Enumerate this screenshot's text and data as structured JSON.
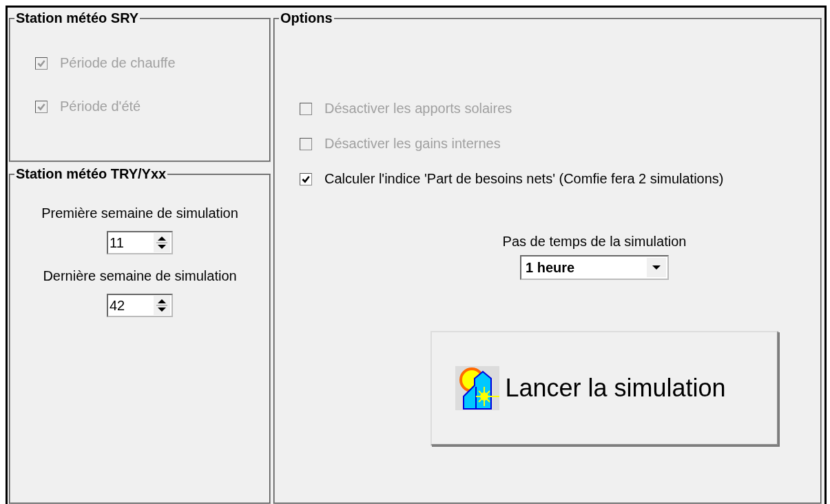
{
  "sry_group": {
    "title": "Station météo SRY",
    "checkboxes": [
      {
        "label": "Période de chauffe",
        "checked": true,
        "disabled": true
      },
      {
        "label": "Période d'été",
        "checked": true,
        "disabled": true
      }
    ]
  },
  "try_group": {
    "title": "Station météo TRY/Yxx",
    "spinners": [
      {
        "label": "Première semaine de simulation",
        "value": "11"
      },
      {
        "label": "Dernière semaine de simulation",
        "value": "42"
      }
    ]
  },
  "options_group": {
    "title": "Options",
    "checkboxes": [
      {
        "label": "Désactiver les apports solaires",
        "checked": false,
        "disabled": true
      },
      {
        "label": "Désactiver les gains internes",
        "checked": false,
        "disabled": true
      },
      {
        "label": "Calculer l'indice 'Part de besoins nets' (Comfie fera 2 simulations)",
        "checked": true,
        "disabled": false
      }
    ],
    "time_step": {
      "label": "Pas de temps de la simulation",
      "value": "1 heure"
    },
    "run_button": {
      "label": "Lancer la simulation"
    }
  }
}
